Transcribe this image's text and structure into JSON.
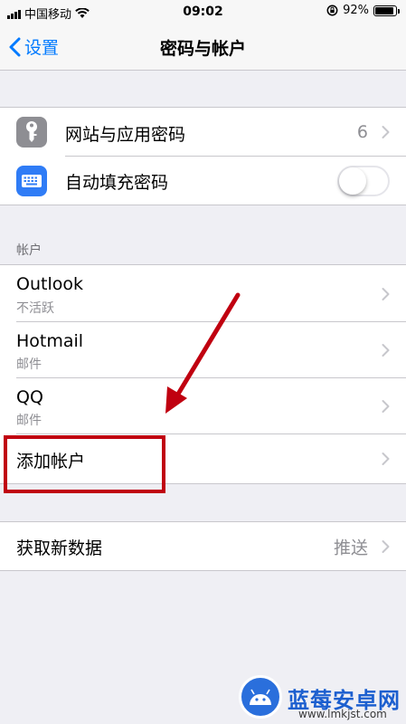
{
  "status_bar": {
    "carrier": "中国移动",
    "time": "09:02",
    "battery_percent": "92%",
    "battery_level": 0.92,
    "icons": [
      "signal-icon",
      "wifi-icon",
      "rotation-lock-icon",
      "battery-icon"
    ]
  },
  "nav": {
    "back_label": "设置",
    "title": "密码与帐户",
    "accent_color": "#007aff"
  },
  "passwords_section": {
    "website_passwords": {
      "label": "网站与应用密码",
      "count": "6",
      "icon": "key-icon",
      "icon_color": "#8e8e93"
    },
    "autofill": {
      "label": "自动填充密码",
      "enabled": false,
      "icon": "keyboard-icon",
      "icon_color": "#2f7cf6"
    }
  },
  "accounts_section": {
    "header": "帐户",
    "accounts": [
      {
        "name": "Outlook",
        "detail": "不活跃"
      },
      {
        "name": "Hotmail",
        "detail": "邮件"
      },
      {
        "name": "QQ",
        "detail": "邮件"
      }
    ],
    "add_account_label": "添加帐户"
  },
  "fetch_section": {
    "label": "获取新数据",
    "value": "推送"
  },
  "annotation": {
    "color": "#c00010"
  },
  "watermark": {
    "title": "蓝莓安卓网",
    "url": "www.lmkjst.com"
  }
}
